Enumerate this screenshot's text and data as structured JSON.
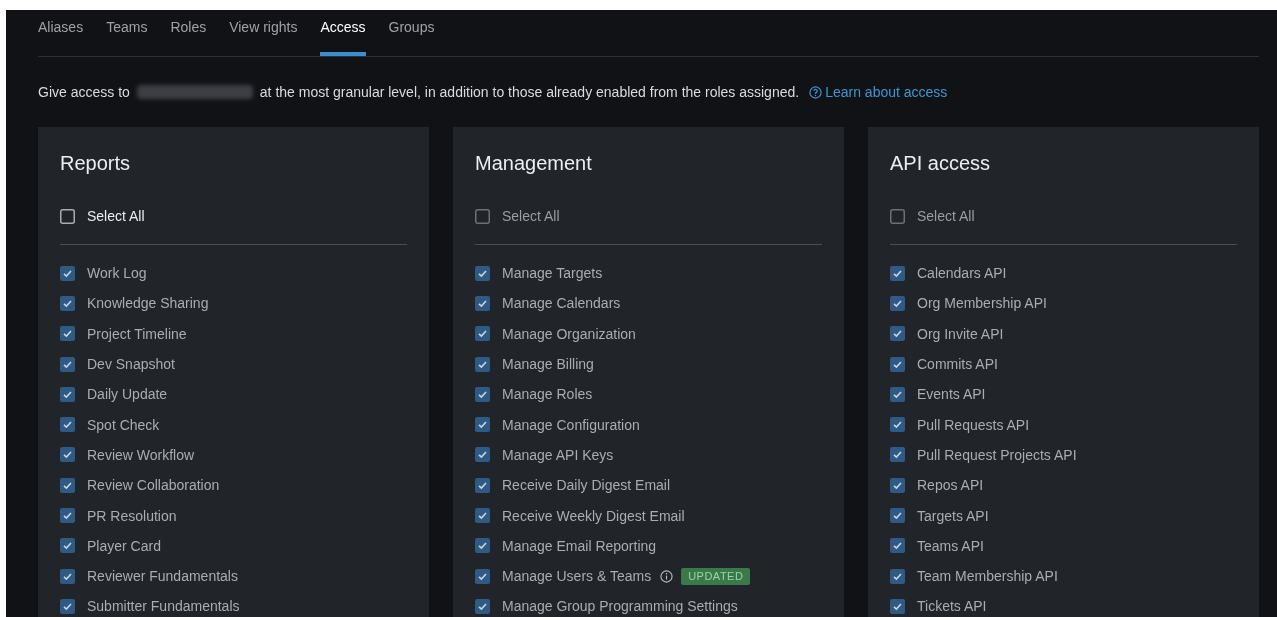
{
  "tabs": [
    {
      "label": "Aliases",
      "selected": false
    },
    {
      "label": "Teams",
      "selected": false
    },
    {
      "label": "Roles",
      "selected": false
    },
    {
      "label": "View rights",
      "selected": false
    },
    {
      "label": "Access",
      "selected": true
    },
    {
      "label": "Groups",
      "selected": false
    }
  ],
  "intro": {
    "before": "Give access to",
    "after": "at the most granular level, in addition to those already enabled from the roles assigned.",
    "link": "Learn about access"
  },
  "panels": [
    {
      "title": "Reports",
      "select_all": {
        "label": "Select All",
        "checked": false,
        "disabled": false
      },
      "items": [
        {
          "label": "Work Log",
          "checked": true
        },
        {
          "label": "Knowledge Sharing",
          "checked": true
        },
        {
          "label": "Project Timeline",
          "checked": true
        },
        {
          "label": "Dev Snapshot",
          "checked": true
        },
        {
          "label": "Daily Update",
          "checked": true
        },
        {
          "label": "Spot Check",
          "checked": true
        },
        {
          "label": "Review Workflow",
          "checked": true
        },
        {
          "label": "Review Collaboration",
          "checked": true
        },
        {
          "label": "PR Resolution",
          "checked": true
        },
        {
          "label": "Player Card",
          "checked": true
        },
        {
          "label": "Reviewer Fundamentals",
          "checked": true
        },
        {
          "label": "Submitter Fundamentals",
          "checked": true
        }
      ]
    },
    {
      "title": "Management",
      "select_all": {
        "label": "Select All",
        "checked": false,
        "disabled": true
      },
      "items": [
        {
          "label": "Manage Targets",
          "checked": true
        },
        {
          "label": "Manage Calendars",
          "checked": true
        },
        {
          "label": "Manage Organization",
          "checked": true
        },
        {
          "label": "Manage Billing",
          "checked": true
        },
        {
          "label": "Manage Roles",
          "checked": true
        },
        {
          "label": "Manage Configuration",
          "checked": true
        },
        {
          "label": "Manage API Keys",
          "checked": true
        },
        {
          "label": "Receive Daily Digest Email",
          "checked": true
        },
        {
          "label": "Receive Weekly Digest Email",
          "checked": true
        },
        {
          "label": "Manage Email Reporting",
          "checked": true
        },
        {
          "label": "Manage Users & Teams",
          "checked": true,
          "info": true,
          "badge": "UPDATED"
        },
        {
          "label": "Manage Group Programming Settings",
          "checked": true
        }
      ]
    },
    {
      "title": "API access",
      "select_all": {
        "label": "Select All",
        "checked": false,
        "disabled": true
      },
      "items": [
        {
          "label": "Calendars API",
          "checked": true
        },
        {
          "label": "Org Membership API",
          "checked": true
        },
        {
          "label": "Org Invite API",
          "checked": true
        },
        {
          "label": "Commits API",
          "checked": true
        },
        {
          "label": "Events API",
          "checked": true
        },
        {
          "label": "Pull Requests API",
          "checked": true
        },
        {
          "label": "Pull Request Projects API",
          "checked": true
        },
        {
          "label": "Repos API",
          "checked": true
        },
        {
          "label": "Targets API",
          "checked": true
        },
        {
          "label": "Teams API",
          "checked": true
        },
        {
          "label": "Team Membership API",
          "checked": true
        },
        {
          "label": "Tickets API",
          "checked": true
        }
      ]
    }
  ]
}
